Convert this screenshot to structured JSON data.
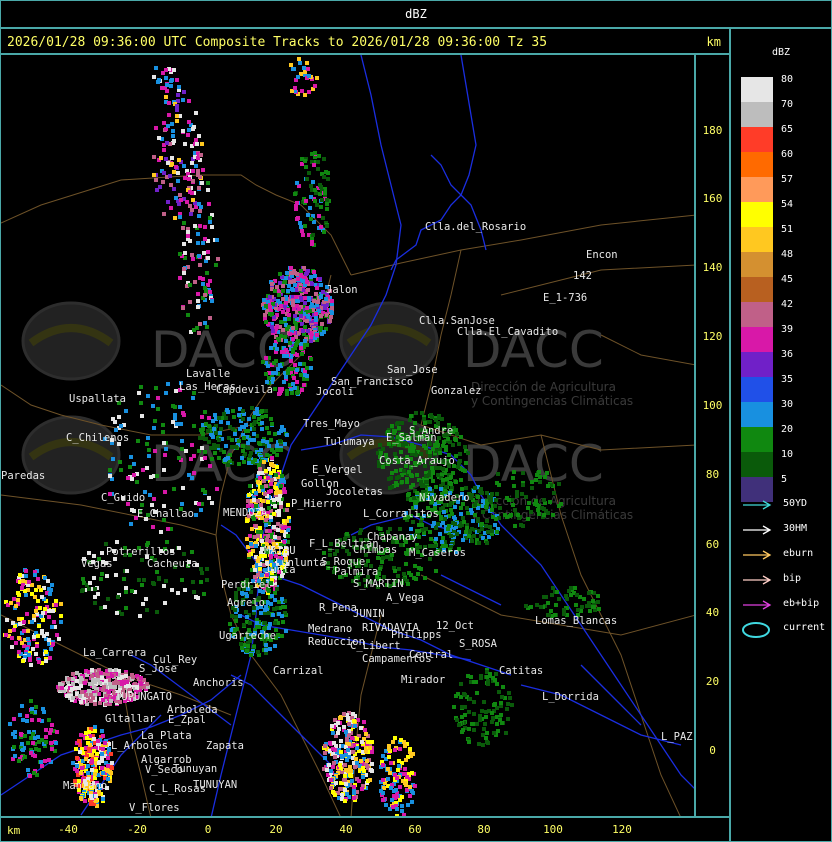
{
  "top_title": "dBZ",
  "map_title": "2026/01/28 09:36:00 UTC Composite Tracks to 2026/01/28 09:36:00 Tz 35",
  "units_km": "km",
  "y_ticks": [
    "180",
    "160",
    "140",
    "120",
    "100",
    "80",
    "60",
    "40",
    "20",
    "0"
  ],
  "x_ticks": [
    "-40",
    "-20",
    "0",
    "20",
    "40",
    "60",
    "80",
    "100",
    "120"
  ],
  "legend": {
    "title": "dBZ",
    "scale": [
      {
        "label": "80",
        "color": "#e6e6e6"
      },
      {
        "label": "70",
        "color": "#bdbdbd"
      },
      {
        "label": "65",
        "color": "#ff3c28"
      },
      {
        "label": "60",
        "color": "#ff6a00"
      },
      {
        "label": "57",
        "color": "#ff9a5a"
      },
      {
        "label": "54",
        "color": "#ffff00"
      },
      {
        "label": "51",
        "color": "#ffc820"
      },
      {
        "label": "48",
        "color": "#d49030"
      },
      {
        "label": "45",
        "color": "#b86020"
      },
      {
        "label": "42",
        "color": "#c06088"
      },
      {
        "label": "39",
        "color": "#d818a8"
      },
      {
        "label": "36",
        "color": "#7020c8"
      },
      {
        "label": "35",
        "color": "#2050e8"
      },
      {
        "label": "30",
        "color": "#1890e0"
      },
      {
        "label": "20",
        "color": "#108810"
      },
      {
        "label": "10",
        "color": "#0a5a0a"
      },
      {
        "label": "5",
        "color": "#40307a"
      }
    ],
    "tracks": [
      {
        "label": "50YD",
        "color": "#40d8d8"
      },
      {
        "label": "30HM",
        "color": "#ffffff"
      },
      {
        "label": "eburn",
        "color": "#ffc860"
      },
      {
        "label": "bip",
        "color": "#ffd0c8"
      },
      {
        "label": "eb+bip",
        "color": "#e040e0"
      }
    ],
    "current_label": "current",
    "current_color": "#40d8e0"
  },
  "watermark": {
    "brand": "DACC",
    "line1": "Dirección de Agricultura",
    "line2": "y Contingencias Climáticas"
  },
  "places": [
    {
      "name": "Clla.del_Rosario"
    },
    {
      "name": "Encon"
    },
    {
      "name": "142"
    },
    {
      "name": "E_1-736"
    },
    {
      "name": "Clla.SanJose"
    },
    {
      "name": "Clla.El_Cavadito"
    },
    {
      "name": "Jalon"
    },
    {
      "name": "Uspallata"
    },
    {
      "name": "Tres_Mayo"
    },
    {
      "name": "Tulumaya"
    },
    {
      "name": "E_Salman"
    },
    {
      "name": "San_Francisco"
    },
    {
      "name": "Jocoli"
    },
    {
      "name": "Capdevila"
    },
    {
      "name": "Lavalle"
    },
    {
      "name": "C_Chilenos"
    },
    {
      "name": "Paredas"
    },
    {
      "name": "C_Guido"
    },
    {
      "name": "E_Challao"
    },
    {
      "name": "Potrerillos"
    },
    {
      "name": "Vegas"
    },
    {
      "name": "Cacheuta"
    },
    {
      "name": "P_Hierro"
    },
    {
      "name": "Costa_Araujo"
    },
    {
      "name": "E_Vergel"
    },
    {
      "name": "Gollon"
    },
    {
      "name": "Jocoletas"
    },
    {
      "name": "Chapanay"
    },
    {
      "name": "Chimbas"
    },
    {
      "name": "M_Caseros"
    },
    {
      "name": "F_L_Beltran"
    },
    {
      "name": "Palmira"
    },
    {
      "name": "S_MARTIN"
    },
    {
      "name": "Perdriel"
    },
    {
      "name": "Agrelo"
    },
    {
      "name": "Ugarteche"
    },
    {
      "name": "S_Roque"
    },
    {
      "name": "JUNIN"
    },
    {
      "name": "R_Pena"
    },
    {
      "name": "A_Vega"
    },
    {
      "name": "Medrano"
    },
    {
      "name": "Reduccion"
    },
    {
      "name": "RIVADAVIA"
    },
    {
      "name": "12_Oct"
    },
    {
      "name": "S_ROSA"
    },
    {
      "name": "Lomas_Blancas"
    },
    {
      "name": "Carrizal"
    },
    {
      "name": "Campamentos"
    },
    {
      "name": "Central"
    },
    {
      "name": "Mirador"
    },
    {
      "name": "Catitas"
    },
    {
      "name": "L_Dorrida"
    },
    {
      "name": "L_PAZ"
    },
    {
      "name": "La_Carrera"
    },
    {
      "name": "S_Jose"
    },
    {
      "name": "Cul_Rey"
    },
    {
      "name": "TUPUNGATO"
    },
    {
      "name": "Anchoris"
    },
    {
      "name": "Arboleda"
    },
    {
      "name": "Gltallar"
    },
    {
      "name": "E_Zpal"
    },
    {
      "name": "La_Plata"
    },
    {
      "name": "Zapata"
    },
    {
      "name": "L_Arboles"
    },
    {
      "name": "Algarrob"
    },
    {
      "name": "V_Seco"
    },
    {
      "name": "Tunuyan"
    },
    {
      "name": "TUNUYAN"
    },
    {
      "name": "C_L_Rosas"
    },
    {
      "name": "V_Flores"
    },
    {
      "name": "Manzano"
    },
    {
      "name": "Nivadero"
    },
    {
      "name": "L_Corralitos"
    },
    {
      "name": "Junta"
    },
    {
      "name": "MAIPU"
    },
    {
      "name": "Lunlunta"
    },
    {
      "name": "MENDOZA"
    },
    {
      "name": "Philipps"
    },
    {
      "name": "C_Libert"
    },
    {
      "name": "S_Andre"
    },
    {
      "name": "Gonzalez"
    },
    {
      "name": "San_Jose"
    },
    {
      "name": "Las_Heras"
    }
  ]
}
